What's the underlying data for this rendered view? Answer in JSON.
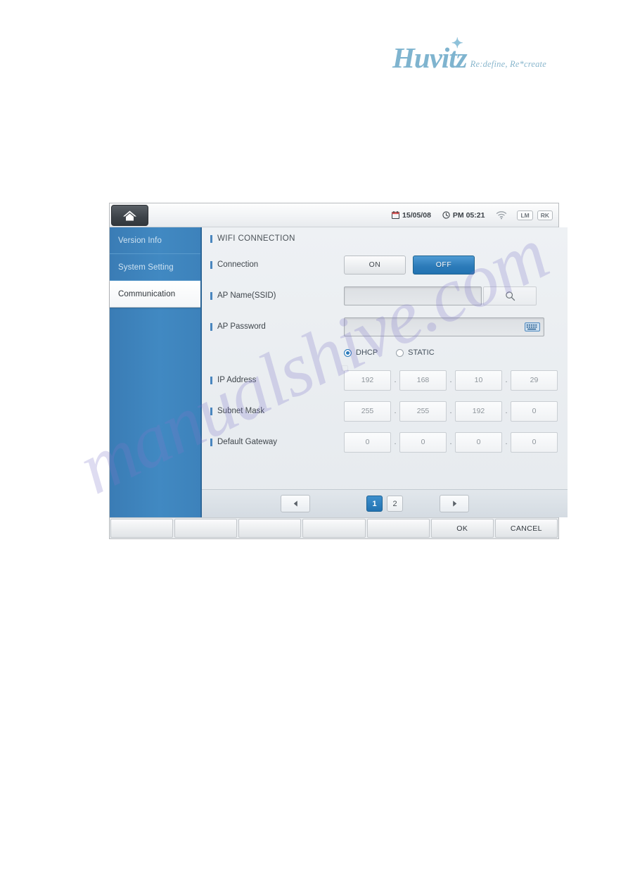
{
  "brand": {
    "name": "Huvitz",
    "tagline": "Re:define, Re*create"
  },
  "watermark": "manualshive.com",
  "device": {
    "statusbar": {
      "home_icon": "home-icon",
      "date": "15/05/08",
      "time": "PM 05:21",
      "calendar_icon": "calendar-icon",
      "clock_icon": "clock-icon",
      "wifi_icon": "wifi-icon",
      "badges": [
        "LM",
        "RK"
      ]
    },
    "sidebar": {
      "items": [
        {
          "label": "Version Info",
          "active": false
        },
        {
          "label": "System Setting",
          "active": false
        },
        {
          "label": "Communication",
          "active": true
        }
      ]
    },
    "panel": {
      "title": "WIFI CONNECTION",
      "connection": {
        "label": "Connection",
        "on_label": "ON",
        "off_label": "OFF",
        "selected": "OFF"
      },
      "ap_name": {
        "label": "AP Name(SSID)",
        "value": "",
        "search_icon": "search-icon"
      },
      "ap_password": {
        "label": "AP Password",
        "value": "",
        "keyboard_icon": "keyboard-icon"
      },
      "ip_mode": {
        "options": [
          "DHCP",
          "STATIC"
        ],
        "selected": "DHCP"
      },
      "ip_address": {
        "label": "IP Address",
        "octets": [
          "192",
          "168",
          "10",
          "29"
        ]
      },
      "subnet_mask": {
        "label": "Subnet Mask",
        "octets": [
          "255",
          "255",
          "192",
          "0"
        ]
      },
      "default_gateway": {
        "label": "Default Gateway",
        "octets": [
          "0",
          "0",
          "0",
          "0"
        ]
      },
      "separator": "."
    },
    "pager": {
      "prev_icon": "arrow-left-icon",
      "next_icon": "arrow-right-icon",
      "pages": [
        "1",
        "2"
      ],
      "current": "1"
    },
    "toolbar": {
      "buttons": [
        "",
        "",
        "",
        "",
        "",
        "OK",
        "CANCEL"
      ]
    }
  }
}
